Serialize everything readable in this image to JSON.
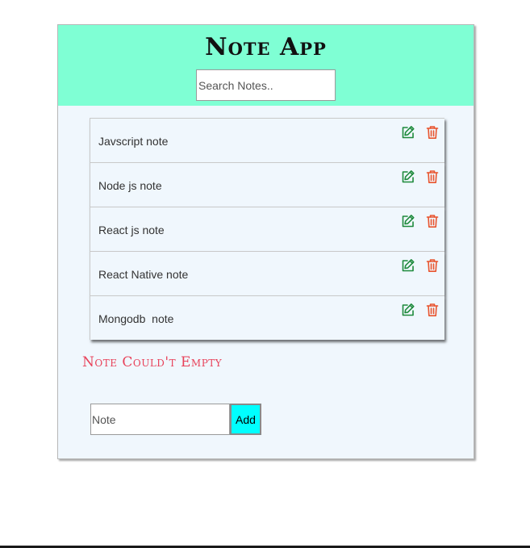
{
  "app": {
    "title": "Note App"
  },
  "search": {
    "placeholder": "Search Notes.."
  },
  "notes": [
    {
      "text": "Javscript note"
    },
    {
      "text": "Node js note"
    },
    {
      "text": "React js note"
    },
    {
      "text": "React Native note"
    },
    {
      "text": "Mongodb  note"
    }
  ],
  "error": {
    "message": "Note Could't Empty"
  },
  "add_form": {
    "placeholder": "Note",
    "button_label": "Add"
  },
  "icons": {
    "edit": "edit-icon",
    "delete": "trash-icon"
  },
  "colors": {
    "header": "#7fffd4",
    "card": "#f0f7fd",
    "edit_icon": "#1e8a3c",
    "delete_icon": "#e8542e",
    "error": "#e8425a",
    "add_button": "#00ffff"
  }
}
